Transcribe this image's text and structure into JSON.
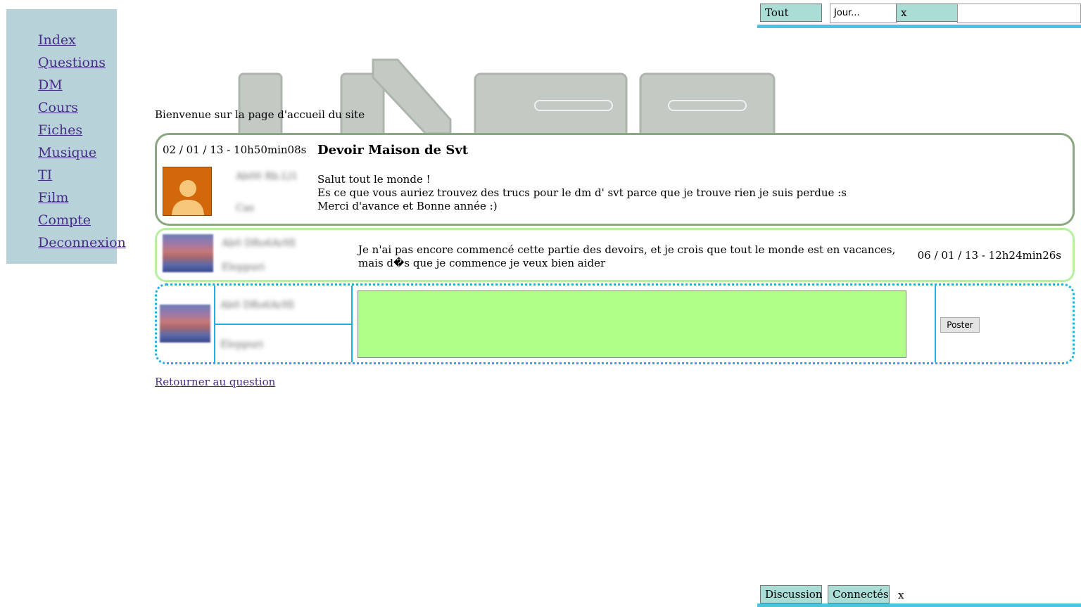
{
  "topbar": {
    "tab_all": "Tout",
    "input_value": "Jour...",
    "close": "x"
  },
  "sidebar": {
    "items": [
      {
        "label": "Index"
      },
      {
        "label": "Questions"
      },
      {
        "label": "DM"
      },
      {
        "label": "Cours"
      },
      {
        "label": "Fiches"
      },
      {
        "label": "Musique"
      },
      {
        "label": "TI"
      },
      {
        "label": "Film"
      },
      {
        "label": "Compte"
      },
      {
        "label": "Deconnexion"
      }
    ]
  },
  "welcome": "Bienvenue sur la page d'accueil du site",
  "question": {
    "date": "02 / 01 / 13 - 10h50min08s",
    "title": "Devoir Maison de Svt",
    "author_blurred": "Ab00 Rb.Ll1",
    "role_blurred": "Cas",
    "body_lines": [
      "Salut tout le monde !",
      "Es ce que vous auriez trouvez des trucs pour le dm d' svt parce que je trouve rien je suis perdue :s",
      "Merci d'avance et Bonne année :)"
    ]
  },
  "answer": {
    "author_blurred": "Ab0 DRo6ArHl",
    "role_blurred": "Eleppuri",
    "text": "Je n'ai pas encore commencé cette partie des devoirs, et je crois que tout le monde est en vacances, mais d�s que je commence je veux bien aider",
    "date": "06 / 01 / 13 - 12h24min26s"
  },
  "reply": {
    "author_blurred": "Ab0 DRo6ArHl",
    "role_blurred": "Eleppuri",
    "textarea_value": "",
    "post_button": "Poster"
  },
  "back_link": "Retourner au question",
  "bottombar": {
    "tab_discussion": "Discussion",
    "tab_connected": "Connectés",
    "close": "x"
  },
  "colors": {
    "sidebar_bg": "#b7d3d9",
    "tab_bg": "#aaddd5",
    "accent_line": "#4fc1e0",
    "question_border": "#8ba883",
    "answer_border": "#b6f0a1",
    "reply_border": "#1cb1e3",
    "textarea_bg": "#b0ff88",
    "link": "#4a2b8a"
  }
}
